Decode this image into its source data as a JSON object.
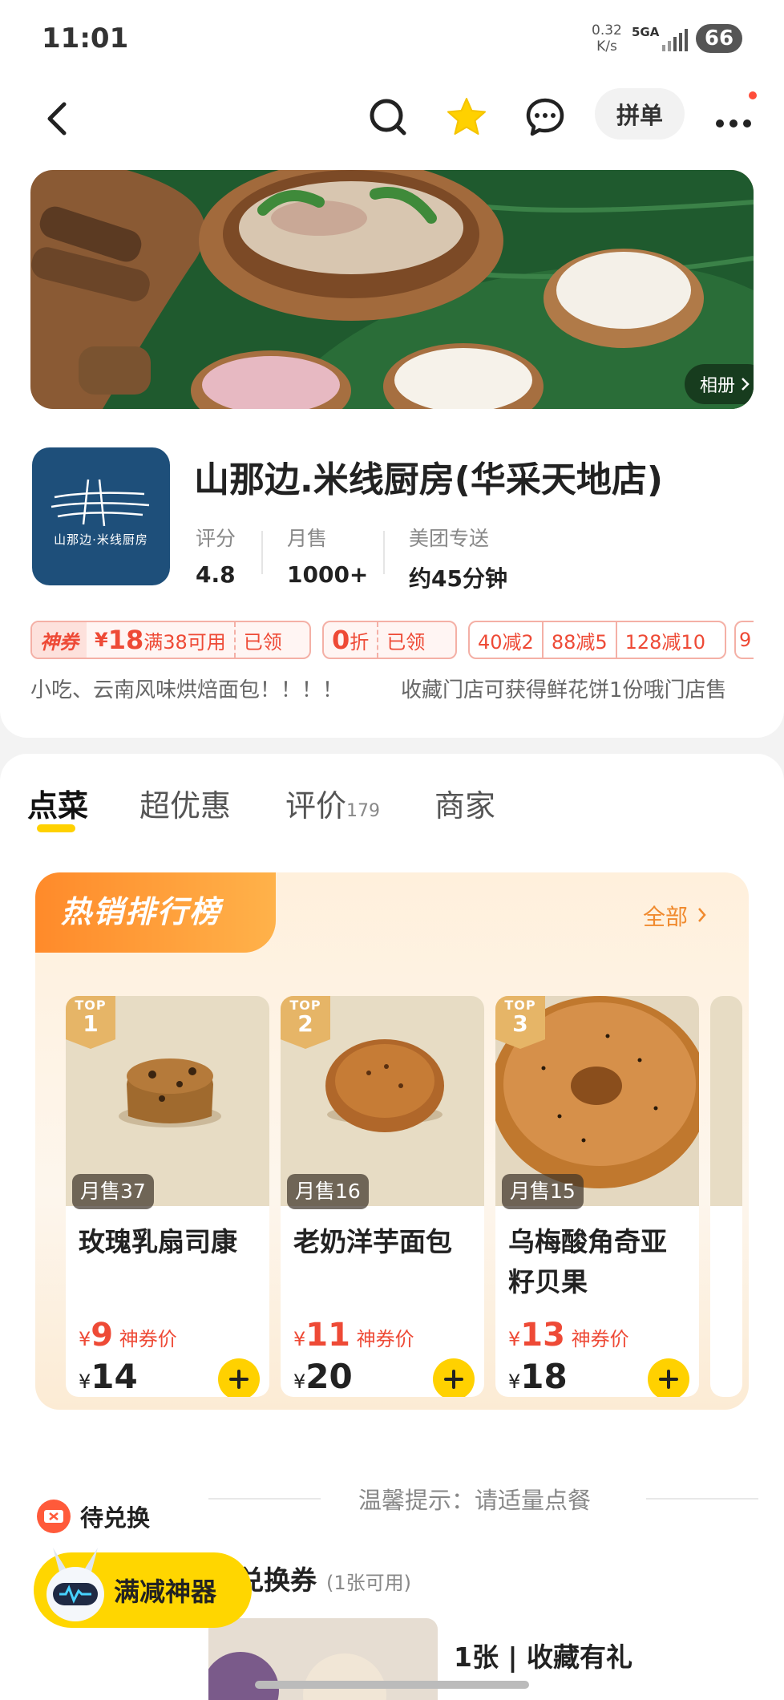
{
  "status_bar": {
    "time": "11:01",
    "net_speed": "0.32",
    "net_unit": "K/s",
    "network": "5GA",
    "battery": "66"
  },
  "nav": {
    "pin_label": "拼单"
  },
  "banner": {
    "album_label": "相册"
  },
  "store": {
    "logo_text": "山那边·米线厨房",
    "name": "山那边.米线厨房(华采天地店)",
    "stats": [
      {
        "label": "评分",
        "value": "4.8"
      },
      {
        "label": "月售",
        "value": "1000+"
      },
      {
        "label": "美团专送",
        "value": "约45分钟"
      }
    ],
    "coupons": {
      "god_tag": "神券",
      "god_currency": "¥",
      "god_amount": "18",
      "god_condition": "满38可用",
      "god_status": "已领",
      "discount_value": "0",
      "discount_unit": "折",
      "discount_status": "已领",
      "reductions": [
        "40减2",
        "88减5",
        "128减10"
      ],
      "more": "9"
    },
    "notice_left": "小吃、云南风味烘焙面包！！！！",
    "notice_right": "收藏门店可获得鲜花饼1份哦门店售"
  },
  "tabs": [
    {
      "label": "点菜"
    },
    {
      "label": "超优惠"
    },
    {
      "label": "评价",
      "count": "179"
    },
    {
      "label": "商家"
    }
  ],
  "ranking": {
    "title": "热销排行榜",
    "all_label": "全部",
    "top_label": "TOP",
    "items": [
      {
        "rank": "1",
        "sold": "月售37",
        "name": "玫瑰乳扇司康",
        "god_price": "9",
        "god_label": "神券价",
        "price": "14",
        "currency": "¥"
      },
      {
        "rank": "2",
        "sold": "月售16",
        "name": "老奶洋芋面包",
        "god_price": "11",
        "god_label": "神券价",
        "price": "20",
        "currency": "¥"
      },
      {
        "rank": "3",
        "sold": "月售15",
        "name": "乌梅酸角奇亚籽贝果",
        "god_price": "13",
        "god_label": "神券价",
        "price": "18",
        "currency": "¥"
      }
    ]
  },
  "tip": "温馨提示：请适量点餐",
  "redeem": {
    "label": "待兑换"
  },
  "voucher": {
    "title": "兑换券",
    "available": "(1张可用)",
    "count": "1张",
    "desc": "收藏有礼"
  },
  "manjian": {
    "label": "满减神器"
  },
  "colors": {
    "accent": "#ffd100",
    "price_red": "#ee4a36",
    "rank_orange": "#ff8a2a"
  }
}
